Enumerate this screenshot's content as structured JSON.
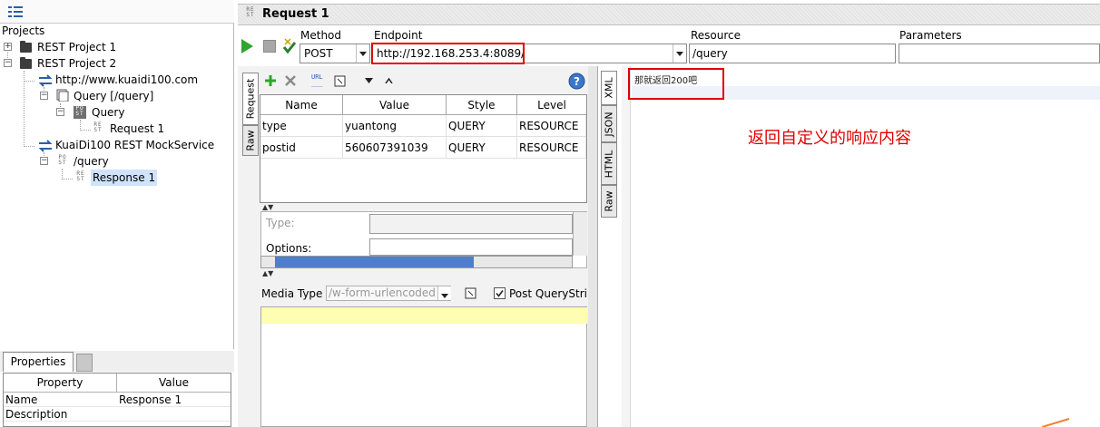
{
  "navigator": {
    "title": "Projects",
    "tree": [
      {
        "label": "REST Project 1"
      },
      {
        "label": "REST Project 2"
      },
      {
        "label": "http://www.kuaidi100.com"
      },
      {
        "label": "Query [/query]"
      },
      {
        "label": "Query"
      },
      {
        "label": "Request 1"
      },
      {
        "label": "KuaiDi100 REST MockService"
      },
      {
        "label": "/query"
      },
      {
        "label": "Response 1"
      }
    ]
  },
  "properties": {
    "tab": "Properties",
    "columns": [
      "Property",
      "Value"
    ],
    "rows": [
      {
        "property": "Name",
        "value": "Response 1"
      },
      {
        "property": "Description",
        "value": ""
      }
    ]
  },
  "request": {
    "title": "Request 1",
    "method_label": "Method",
    "method": "POST",
    "endpoint_label": "Endpoint",
    "endpoint": "http://192.168.253.4:8089/",
    "resource_label": "Resource",
    "resource": "/query",
    "parameters_label": "Parameters",
    "parameters": "",
    "left_tabs": [
      "Request",
      "Raw"
    ],
    "params_table": {
      "columns": [
        "Name",
        "Value",
        "Style",
        "Level"
      ],
      "rows": [
        {
          "name": "type",
          "value": "yuantong",
          "style": "QUERY",
          "level": "RESOURCE"
        },
        {
          "name": "postid",
          "value": "560607391039",
          "style": "QUERY",
          "level": "RESOURCE"
        }
      ]
    },
    "details": {
      "type_label": "Type:",
      "options_label": "Options:"
    },
    "media_type_label": "Media Type",
    "media_type": "/w-form-urlencoded",
    "post_querystring_label": "Post QueryStrir",
    "post_querystring_checked": true
  },
  "response": {
    "tabs": [
      "XML",
      "JSON",
      "HTML",
      "Raw"
    ],
    "content": "那就返回200吧",
    "annotation": "返回自定义的响应内容"
  },
  "colors": {
    "highlight": "#e00000",
    "accent": "#2ea52e",
    "selection": "#cfe3fb"
  },
  "icons": [
    "tree-view-icon",
    "folder-icon",
    "rest-icon",
    "run-icon",
    "stop-icon",
    "check-icon",
    "add-icon",
    "delete-icon",
    "help-icon"
  ]
}
